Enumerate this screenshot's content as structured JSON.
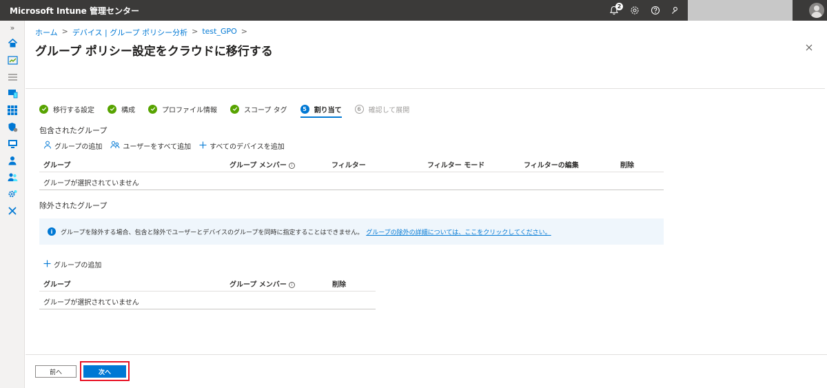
{
  "app": {
    "title": "Microsoft Intune 管理センター",
    "notification_count": "2"
  },
  "breadcrumb": [
    "ホーム",
    "デバイス | グループ ポリシー分析",
    "test_GPO"
  ],
  "page": {
    "title": "グループ ポリシー設定をクラウドに移行する",
    "more": "···"
  },
  "wizard": {
    "steps": [
      {
        "label": "移行する設定",
        "state": "completed"
      },
      {
        "label": "構成",
        "state": "completed"
      },
      {
        "label": "プロファイル情報",
        "state": "completed"
      },
      {
        "label": "スコープ タグ",
        "state": "completed"
      },
      {
        "label": "割り当て",
        "state": "active",
        "number": "5"
      },
      {
        "label": "確認して展開",
        "state": "disabled",
        "number": "6"
      }
    ]
  },
  "included": {
    "title": "包含されたグループ",
    "actions": {
      "add_group": "グループの追加",
      "add_all_users": "ユーザーをすべて追加",
      "add_all_devices": "すべてのデバイスを追加"
    },
    "columns": [
      "グループ",
      "グループ メンバー",
      "フィルター",
      "フィルター モード",
      "フィルターの編集",
      "削除"
    ],
    "empty": "グループが選択されていません"
  },
  "excluded": {
    "title": "除外されたグループ",
    "info": "グループを除外する場合、包含と除外でユーザーとデバイスのグループを同時に指定することはできません。",
    "info_link": "グループの除外の詳細については、ここをクリックしてください。",
    "actions": {
      "add_group": "グループの追加"
    },
    "columns": [
      "グループ",
      "グループ メンバー",
      "削除"
    ],
    "empty": "グループが選択されていません"
  },
  "footer": {
    "prev": "前へ",
    "next": "次へ"
  },
  "colors": {
    "accent": "#0078d4",
    "success": "#57a300",
    "highlight": "#e81123",
    "topbar": "#3b3a39"
  }
}
